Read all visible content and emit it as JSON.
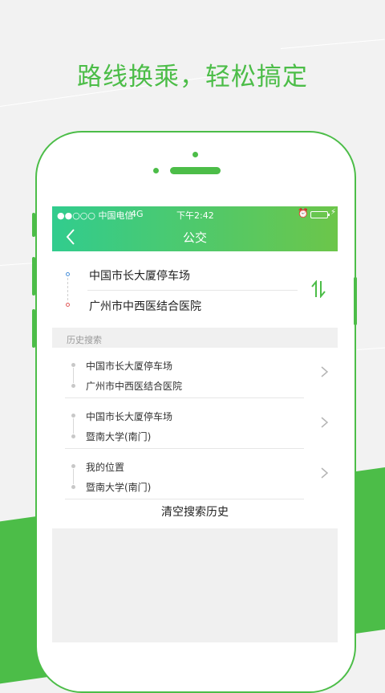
{
  "headline": "路线换乘，轻松搞定",
  "colors": {
    "brand_green": "#4cbd48",
    "gradient_start": "#31cc8e",
    "gradient_end": "#6cc64a"
  },
  "status_bar": {
    "carrier": "●●○○○ 中国电信",
    "network": "4G",
    "time": "下午2:42",
    "alarm_icon": "alarm-icon",
    "battery_icon": "battery-icon"
  },
  "app_bar": {
    "title": "公交",
    "back_icon": "chevron-left-icon"
  },
  "route": {
    "start": "中国市长大厦停车场",
    "end": "广州市中西医结合医院",
    "swap_icon": "swap-arrows-icon"
  },
  "history": {
    "header": "历史搜索",
    "items": [
      {
        "from": "中国市长大厦停车场",
        "to": "广州市中西医结合医院"
      },
      {
        "from": "中国市长大厦停车场",
        "to": "暨南大学(南门)"
      },
      {
        "from": "我的位置",
        "to": "暨南大学(南门)"
      }
    ],
    "clear_label": "清空搜索历史"
  }
}
